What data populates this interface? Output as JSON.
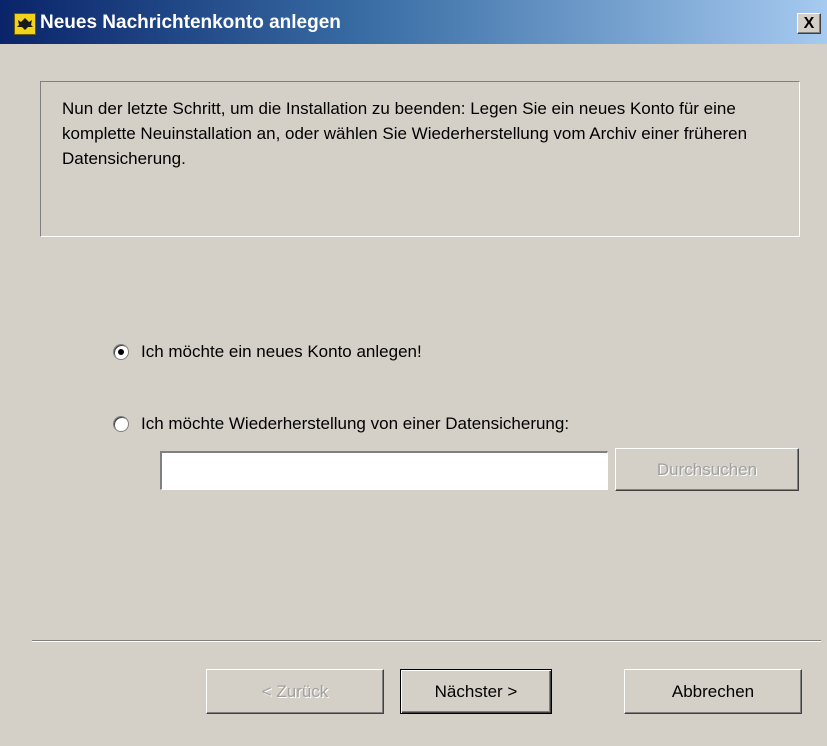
{
  "window": {
    "title": "Neues Nachrichtenkonto anlegen",
    "close_label": "X",
    "icon": "app-icon"
  },
  "info": {
    "text": "Nun der letzte Schritt, um die Installation zu beenden:  Legen Sie ein neues Konto für eine komplette Neuinstallation an, oder wählen Sie Wiederherstellung vom Archiv einer früheren Datensicherung."
  },
  "options": {
    "new_account": {
      "label": "Ich möchte ein neues Konto anlegen!",
      "checked": true
    },
    "restore": {
      "label": "Ich möchte Wiederherstellung von einer Datensicherung:",
      "checked": false
    }
  },
  "backup_path": {
    "value": ""
  },
  "buttons": {
    "browse": "Durchsuchen",
    "back": "< Zurück",
    "next": "Nächster  >",
    "cancel": "Abbrechen"
  },
  "colors": {
    "titlebar_start": "#0a246a",
    "titlebar_end": "#a6caf0",
    "dialog_bg": "#d4d0c8"
  }
}
